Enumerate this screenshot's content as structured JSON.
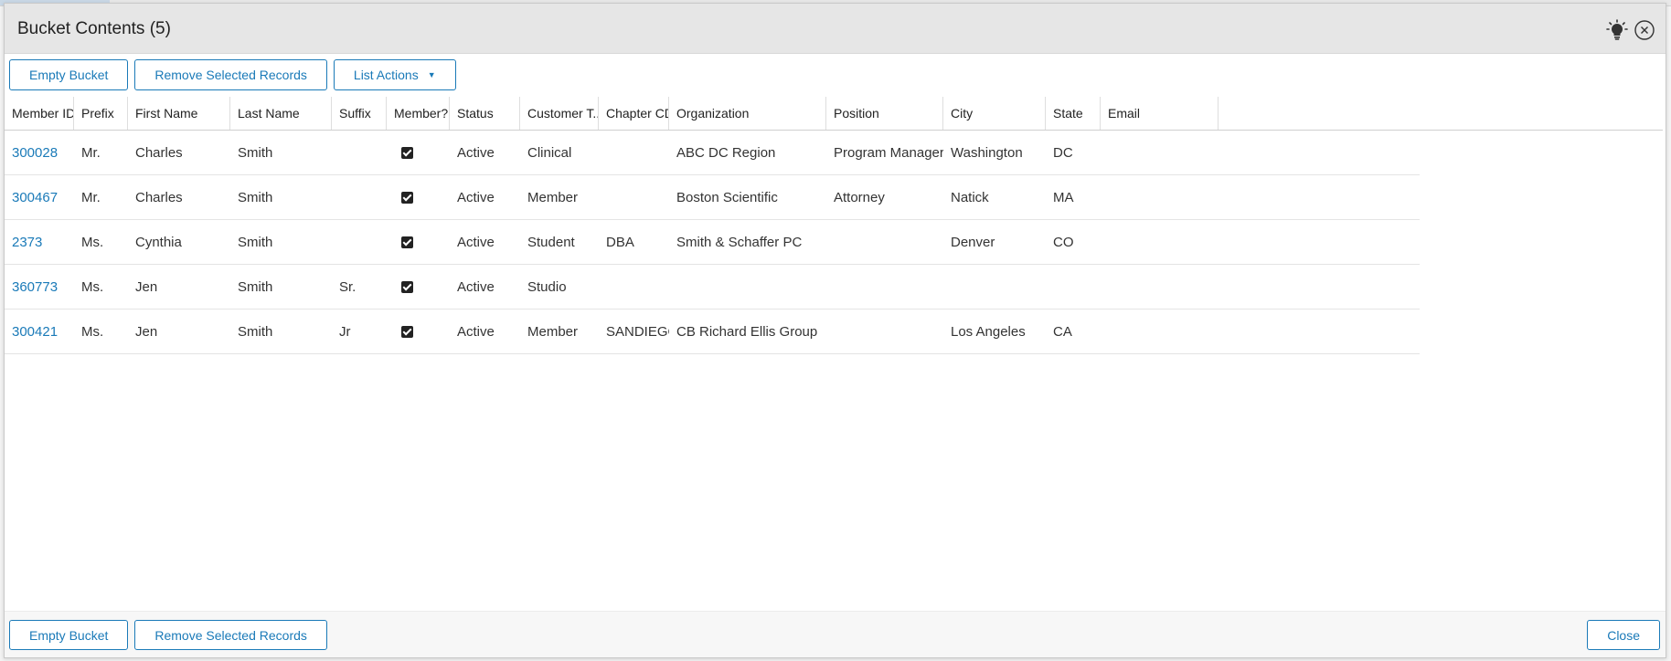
{
  "dialog": {
    "title": "Bucket Contents (5)",
    "icons": [
      "lightbulb-icon",
      "close-icon"
    ]
  },
  "toolbar": {
    "empty_bucket": "Empty Bucket",
    "remove_selected": "Remove Selected Records",
    "list_actions": "List Actions"
  },
  "table": {
    "columns": [
      "Member ID",
      "Prefix",
      "First Name",
      "Last Name",
      "Suffix",
      "Member?",
      "Status",
      "Customer T...",
      "Chapter CD",
      "Organization",
      "Position",
      "City",
      "State",
      "Email"
    ],
    "rows": [
      {
        "member_id": "300028",
        "prefix": "Mr.",
        "first_name": "Charles",
        "last_name": "Smith",
        "suffix": "",
        "member": true,
        "status": "Active",
        "customer_type": "Clinical",
        "chapter_cd": "",
        "organization": "ABC DC Region",
        "position": "Program Manager",
        "city": "Washington",
        "state": "DC",
        "email": ""
      },
      {
        "member_id": "300467",
        "prefix": "Mr.",
        "first_name": "Charles",
        "last_name": "Smith",
        "suffix": "",
        "member": true,
        "status": "Active",
        "customer_type": "Member",
        "chapter_cd": "",
        "organization": "Boston Scientific",
        "position": "Attorney",
        "city": "Natick",
        "state": "MA",
        "email": ""
      },
      {
        "member_id": "2373",
        "prefix": "Ms.",
        "first_name": "Cynthia",
        "last_name": "Smith",
        "suffix": "",
        "member": true,
        "status": "Active",
        "customer_type": "Student",
        "chapter_cd": "DBA",
        "organization": "Smith & Schaffer PC",
        "position": "",
        "city": "Denver",
        "state": "CO",
        "email": ""
      },
      {
        "member_id": "360773",
        "prefix": "Ms.",
        "first_name": "Jen",
        "last_name": "Smith",
        "suffix": "Sr.",
        "member": true,
        "status": "Active",
        "customer_type": "Studio",
        "chapter_cd": "",
        "organization": "",
        "position": "",
        "city": "",
        "state": "",
        "email": ""
      },
      {
        "member_id": "300421",
        "prefix": "Ms.",
        "first_name": "Jen",
        "last_name": "Smith",
        "suffix": "Jr",
        "member": true,
        "status": "Active",
        "customer_type": "Member",
        "chapter_cd": "SANDIEGO",
        "organization": "CB Richard Ellis Group",
        "position": "",
        "city": "Los Angeles",
        "state": "CA",
        "email": ""
      }
    ]
  },
  "footer": {
    "empty_bucket": "Empty Bucket",
    "remove_selected": "Remove Selected Records",
    "close": "Close"
  },
  "colors": {
    "accent": "#1a7ab8",
    "header_bg": "#e6e6e6"
  }
}
